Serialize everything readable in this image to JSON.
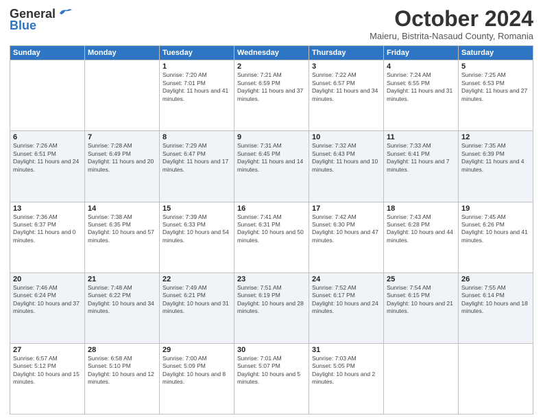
{
  "header": {
    "logo_general": "General",
    "logo_blue": "Blue",
    "month_title": "October 2024",
    "subtitle": "Maieru, Bistrita-Nasaud County, Romania"
  },
  "weekdays": [
    "Sunday",
    "Monday",
    "Tuesday",
    "Wednesday",
    "Thursday",
    "Friday",
    "Saturday"
  ],
  "weeks": [
    [
      {
        "day": "",
        "info": ""
      },
      {
        "day": "",
        "info": ""
      },
      {
        "day": "1",
        "info": "Sunrise: 7:20 AM\nSunset: 7:01 PM\nDaylight: 11 hours and 41 minutes."
      },
      {
        "day": "2",
        "info": "Sunrise: 7:21 AM\nSunset: 6:59 PM\nDaylight: 11 hours and 37 minutes."
      },
      {
        "day": "3",
        "info": "Sunrise: 7:22 AM\nSunset: 6:57 PM\nDaylight: 11 hours and 34 minutes."
      },
      {
        "day": "4",
        "info": "Sunrise: 7:24 AM\nSunset: 6:55 PM\nDaylight: 11 hours and 31 minutes."
      },
      {
        "day": "5",
        "info": "Sunrise: 7:25 AM\nSunset: 6:53 PM\nDaylight: 11 hours and 27 minutes."
      }
    ],
    [
      {
        "day": "6",
        "info": "Sunrise: 7:26 AM\nSunset: 6:51 PM\nDaylight: 11 hours and 24 minutes."
      },
      {
        "day": "7",
        "info": "Sunrise: 7:28 AM\nSunset: 6:49 PM\nDaylight: 11 hours and 20 minutes."
      },
      {
        "day": "8",
        "info": "Sunrise: 7:29 AM\nSunset: 6:47 PM\nDaylight: 11 hours and 17 minutes."
      },
      {
        "day": "9",
        "info": "Sunrise: 7:31 AM\nSunset: 6:45 PM\nDaylight: 11 hours and 14 minutes."
      },
      {
        "day": "10",
        "info": "Sunrise: 7:32 AM\nSunset: 6:43 PM\nDaylight: 11 hours and 10 minutes."
      },
      {
        "day": "11",
        "info": "Sunrise: 7:33 AM\nSunset: 6:41 PM\nDaylight: 11 hours and 7 minutes."
      },
      {
        "day": "12",
        "info": "Sunrise: 7:35 AM\nSunset: 6:39 PM\nDaylight: 11 hours and 4 minutes."
      }
    ],
    [
      {
        "day": "13",
        "info": "Sunrise: 7:36 AM\nSunset: 6:37 PM\nDaylight: 11 hours and 0 minutes."
      },
      {
        "day": "14",
        "info": "Sunrise: 7:38 AM\nSunset: 6:35 PM\nDaylight: 10 hours and 57 minutes."
      },
      {
        "day": "15",
        "info": "Sunrise: 7:39 AM\nSunset: 6:33 PM\nDaylight: 10 hours and 54 minutes."
      },
      {
        "day": "16",
        "info": "Sunrise: 7:41 AM\nSunset: 6:31 PM\nDaylight: 10 hours and 50 minutes."
      },
      {
        "day": "17",
        "info": "Sunrise: 7:42 AM\nSunset: 6:30 PM\nDaylight: 10 hours and 47 minutes."
      },
      {
        "day": "18",
        "info": "Sunrise: 7:43 AM\nSunset: 6:28 PM\nDaylight: 10 hours and 44 minutes."
      },
      {
        "day": "19",
        "info": "Sunrise: 7:45 AM\nSunset: 6:26 PM\nDaylight: 10 hours and 41 minutes."
      }
    ],
    [
      {
        "day": "20",
        "info": "Sunrise: 7:46 AM\nSunset: 6:24 PM\nDaylight: 10 hours and 37 minutes."
      },
      {
        "day": "21",
        "info": "Sunrise: 7:48 AM\nSunset: 6:22 PM\nDaylight: 10 hours and 34 minutes."
      },
      {
        "day": "22",
        "info": "Sunrise: 7:49 AM\nSunset: 6:21 PM\nDaylight: 10 hours and 31 minutes."
      },
      {
        "day": "23",
        "info": "Sunrise: 7:51 AM\nSunset: 6:19 PM\nDaylight: 10 hours and 28 minutes."
      },
      {
        "day": "24",
        "info": "Sunrise: 7:52 AM\nSunset: 6:17 PM\nDaylight: 10 hours and 24 minutes."
      },
      {
        "day": "25",
        "info": "Sunrise: 7:54 AM\nSunset: 6:15 PM\nDaylight: 10 hours and 21 minutes."
      },
      {
        "day": "26",
        "info": "Sunrise: 7:55 AM\nSunset: 6:14 PM\nDaylight: 10 hours and 18 minutes."
      }
    ],
    [
      {
        "day": "27",
        "info": "Sunrise: 6:57 AM\nSunset: 5:12 PM\nDaylight: 10 hours and 15 minutes."
      },
      {
        "day": "28",
        "info": "Sunrise: 6:58 AM\nSunset: 5:10 PM\nDaylight: 10 hours and 12 minutes."
      },
      {
        "day": "29",
        "info": "Sunrise: 7:00 AM\nSunset: 5:09 PM\nDaylight: 10 hours and 8 minutes."
      },
      {
        "day": "30",
        "info": "Sunrise: 7:01 AM\nSunset: 5:07 PM\nDaylight: 10 hours and 5 minutes."
      },
      {
        "day": "31",
        "info": "Sunrise: 7:03 AM\nSunset: 5:05 PM\nDaylight: 10 hours and 2 minutes."
      },
      {
        "day": "",
        "info": ""
      },
      {
        "day": "",
        "info": ""
      }
    ]
  ]
}
